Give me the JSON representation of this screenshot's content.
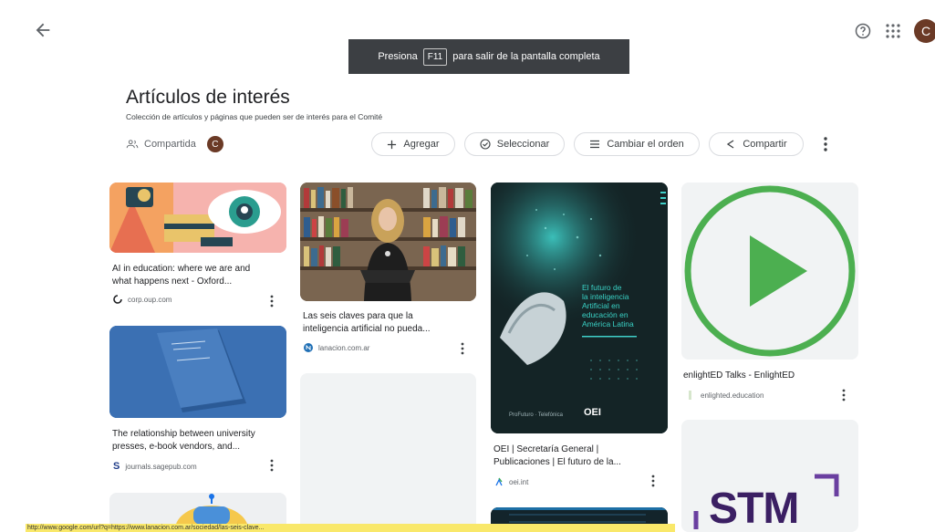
{
  "header": {
    "help_icon": "help-circle-icon",
    "apps_icon": "apps-grid-icon",
    "avatar_letter": "C"
  },
  "fullscreen_toast": {
    "prefix": "Presiona",
    "key": "F11",
    "suffix": "para salir de la pantalla completa"
  },
  "collection": {
    "title": "Artículos de interés",
    "description": "Colección de artículos y páginas que pueden ser de interés para el Comité",
    "shared_label": "Compartida",
    "owner_letter": "C"
  },
  "toolbar": {
    "add_label": "Agregar",
    "select_label": "Seleccionar",
    "reorder_label": "Cambiar el orden",
    "share_label": "Compartir"
  },
  "cards": [
    {
      "title_1": "AI in education: where we are and",
      "title_2": "what happens next - Oxford...",
      "source": "corp.oup.com"
    },
    {
      "title_1": "Las seis claves para que la",
      "title_2": "inteligencia artificial no pueda...",
      "source": "lanacion.com.ar"
    },
    {
      "title_1": "OEI | Secretaría General |",
      "title_2": "Publicaciones | El futuro de la...",
      "source": "oei.int",
      "image_text": [
        "El futuro de",
        "la inteligencia",
        "Artificial en",
        "educación en",
        "América Latina"
      ],
      "image_logo": "OEI"
    },
    {
      "title_1": "enlightED Talks - EnlightED",
      "source": "enlighted.education"
    },
    {
      "title_1": "The relationship between university",
      "title_2": "presses, e-book vendors, and...",
      "source": "journals.sagepub.com"
    },
    {
      "image_text": "STM"
    }
  ],
  "status_bar": {
    "url": "http://www.google.com/url?q=https://www.lanacion.com.ar/sociedad/las-seis-clave..."
  },
  "colors": {
    "accent": "#1a73e8",
    "avatar": "#6b3a26",
    "play_green": "#4caf50",
    "oei_bg": "#142426",
    "journal_blue": "#3a6fb0",
    "stm_purple": "#3b1f63"
  }
}
